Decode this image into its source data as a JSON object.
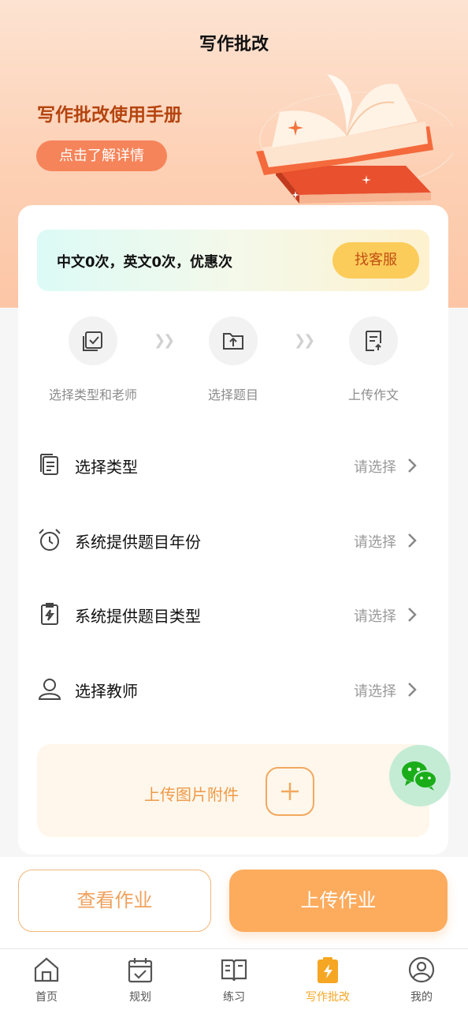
{
  "header": {
    "title": "写作批改"
  },
  "banner": {
    "title": "写作批改使用手册",
    "detail_button": "点击了解详情"
  },
  "quota": {
    "text": "中文0次，英文0次，优惠次",
    "service_button": "找客服"
  },
  "steps": [
    {
      "label": "选择类型和老师",
      "icon": "check-square-icon"
    },
    {
      "label": "选择题目",
      "icon": "folder-upload-icon"
    },
    {
      "label": "上传作文",
      "icon": "document-upload-icon"
    }
  ],
  "form": {
    "rows": [
      {
        "label": "选择类型",
        "value": "请选择",
        "icon": "document-list-icon"
      },
      {
        "label": "系统提供题目年份",
        "value": "请选择",
        "icon": "alarm-clock-icon"
      },
      {
        "label": "系统提供题目类型",
        "value": "请选择",
        "icon": "clipboard-bolt-icon"
      },
      {
        "label": "选择教师",
        "value": "请选择",
        "icon": "user-icon"
      }
    ]
  },
  "upload": {
    "label": "上传图片附件"
  },
  "actions": {
    "view": "查看作业",
    "upload": "上传作业"
  },
  "tabs": [
    {
      "label": "首页",
      "icon": "home-icon"
    },
    {
      "label": "规划",
      "icon": "calendar-check-icon"
    },
    {
      "label": "练习",
      "icon": "book-icon"
    },
    {
      "label": "写作批改",
      "icon": "bolt-clipboard-icon",
      "active": true
    },
    {
      "label": "我的",
      "icon": "profile-icon"
    }
  ],
  "colors": {
    "accent": "#fdab5d",
    "active_tab": "#f5a623",
    "banner_title": "#b5440f",
    "wechat_green": "#1aad19"
  }
}
